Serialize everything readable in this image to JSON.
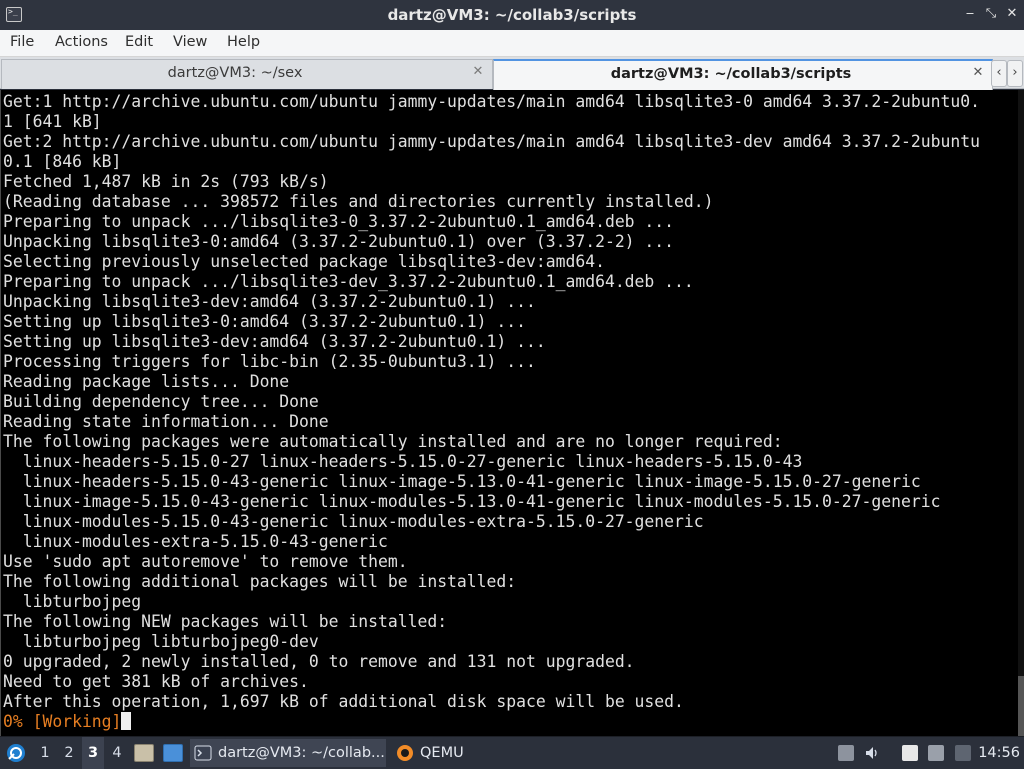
{
  "window": {
    "title": "dartz@VM3: ~/collab3/scripts",
    "controls": {
      "minimize": "‒",
      "maximize": "⤡",
      "close": "✕"
    }
  },
  "menu": [
    "File",
    "Actions",
    "Edit",
    "View",
    "Help"
  ],
  "tabs": [
    {
      "label": "dartz@VM3: ~/sex",
      "close": "✕",
      "active": false
    },
    {
      "label": "dartz@VM3: ~/collab3/scripts",
      "close": "✕",
      "active": true
    }
  ],
  "tab_scroll": {
    "left": "‹",
    "right": "›"
  },
  "terminal": {
    "lines": [
      "Get:1 http://archive.ubuntu.com/ubuntu jammy-updates/main amd64 libsqlite3-0 amd64 3.37.2-2ubuntu0.",
      "1 [641 kB]",
      "Get:2 http://archive.ubuntu.com/ubuntu jammy-updates/main amd64 libsqlite3-dev amd64 3.37.2-2ubuntu",
      "0.1 [846 kB]",
      "Fetched 1,487 kB in 2s (793 kB/s)",
      "(Reading database ... 398572 files and directories currently installed.)",
      "Preparing to unpack .../libsqlite3-0_3.37.2-2ubuntu0.1_amd64.deb ...",
      "Unpacking libsqlite3-0:amd64 (3.37.2-2ubuntu0.1) over (3.37.2-2) ...",
      "Selecting previously unselected package libsqlite3-dev:amd64.",
      "Preparing to unpack .../libsqlite3-dev_3.37.2-2ubuntu0.1_amd64.deb ...",
      "Unpacking libsqlite3-dev:amd64 (3.37.2-2ubuntu0.1) ...",
      "Setting up libsqlite3-0:amd64 (3.37.2-2ubuntu0.1) ...",
      "Setting up libsqlite3-dev:amd64 (3.37.2-2ubuntu0.1) ...",
      "Processing triggers for libc-bin (2.35-0ubuntu3.1) ...",
      "Reading package lists... Done",
      "Building dependency tree... Done",
      "Reading state information... Done",
      "The following packages were automatically installed and are no longer required:",
      "  linux-headers-5.15.0-27 linux-headers-5.15.0-27-generic linux-headers-5.15.0-43",
      "  linux-headers-5.15.0-43-generic linux-image-5.13.0-41-generic linux-image-5.15.0-27-generic",
      "  linux-image-5.15.0-43-generic linux-modules-5.13.0-41-generic linux-modules-5.15.0-27-generic",
      "  linux-modules-5.15.0-43-generic linux-modules-extra-5.15.0-27-generic",
      "  linux-modules-extra-5.15.0-43-generic",
      "Use 'sudo apt autoremove' to remove them.",
      "The following additional packages will be installed:",
      "  libturbojpeg",
      "The following NEW packages will be installed:",
      "  libturbojpeg libturbojpeg0-dev",
      "0 upgraded, 2 newly installed, 0 to remove and 131 not upgraded.",
      "Need to get 381 kB of archives.",
      "After this operation, 1,697 kB of additional disk space will be used."
    ],
    "progress": "0% [Working]",
    "colors": {
      "background": "#000000",
      "text": "#e0e0e0",
      "progress": "#e67e22"
    }
  },
  "taskbar": {
    "workspaces": [
      "1",
      "2",
      "3",
      "4"
    ],
    "active_workspace": "3",
    "tasks": [
      {
        "label": "dartz@VM3: ~/collab...",
        "icon": "terminal-icon",
        "active": true
      },
      {
        "label": "QEMU",
        "icon": "qemu-icon",
        "active": false
      }
    ],
    "clock": "14:56"
  }
}
